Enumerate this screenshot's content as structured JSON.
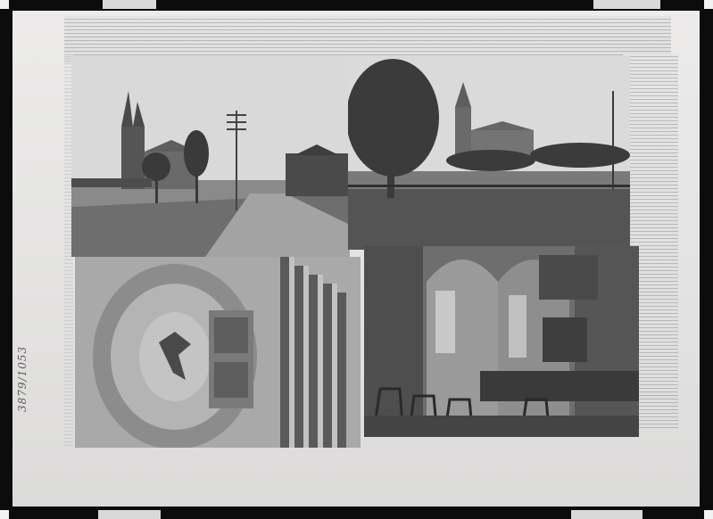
{
  "scene": {
    "description_label": "glass-negative-of-mounted-photo-collage",
    "colors": {
      "frame": "#0c0c0c",
      "plate": "#e6e5e4",
      "newsprint": "#dedede",
      "photo_sky": "#d8d8d8",
      "photo_dark": "#3a3a3a"
    }
  },
  "margin_note": {
    "text": "3879/1053"
  },
  "photos": [
    {
      "id": "church-street",
      "subject": "church-with-spire-and-street"
    },
    {
      "id": "church-park",
      "subject": "church-behind-tree-and-park"
    },
    {
      "id": "interior-ceiling",
      "subject": "church-interior-vault-and-pipes"
    },
    {
      "id": "interior-nave",
      "subject": "church-interior-nave-with-pews"
    }
  ]
}
